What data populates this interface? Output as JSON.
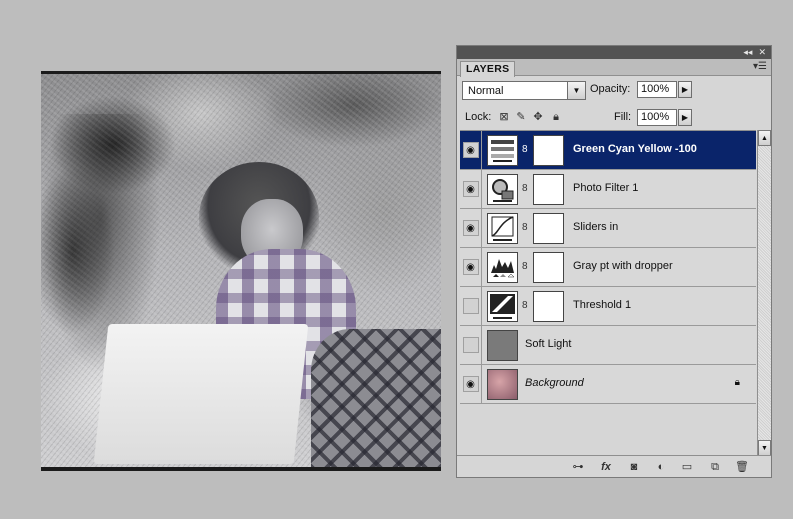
{
  "panel": {
    "title_controls": [
      "◂◂",
      "✕"
    ],
    "tab_label": "LAYERS",
    "menu_icon": "panel-menu-icon"
  },
  "blend": {
    "mode": "Normal",
    "opacity_label": "Opacity:",
    "opacity_value": "100%",
    "fill_label": "Fill:",
    "fill_value": "100%"
  },
  "lock": {
    "label": "Lock:",
    "icons": [
      "lock-transparent-icon",
      "lock-pixels-icon",
      "lock-position-icon",
      "lock-all-icon"
    ]
  },
  "layers": [
    {
      "name": "Green  Cyan Yellow -100",
      "visible": true,
      "selected": true,
      "icon": "color-balance-icon",
      "has_mask": true
    },
    {
      "name": "Photo Filter 1",
      "visible": true,
      "selected": false,
      "icon": "photo-filter-icon",
      "has_mask": true
    },
    {
      "name": "Sliders in",
      "visible": true,
      "selected": false,
      "icon": "curves-icon",
      "has_mask": true
    },
    {
      "name": "Gray pt with dropper",
      "visible": true,
      "selected": false,
      "icon": "levels-icon",
      "has_mask": true
    },
    {
      "name": "Threshold 1",
      "visible": false,
      "selected": false,
      "icon": "threshold-icon",
      "has_mask": true
    },
    {
      "name": "Soft Light",
      "visible": false,
      "selected": false,
      "icon": "gray-fill-icon",
      "has_mask": false
    },
    {
      "name": "Background",
      "visible": true,
      "selected": false,
      "icon": "background-thumbnail",
      "has_mask": false,
      "locked": true
    }
  ],
  "bottom_bar": [
    "link-layers-icon",
    "fx-icon",
    "add-mask-icon",
    "adjustment-layer-icon",
    "new-group-icon",
    "new-layer-icon",
    "trash-icon"
  ],
  "bottom_bar_fx_label": "fx"
}
